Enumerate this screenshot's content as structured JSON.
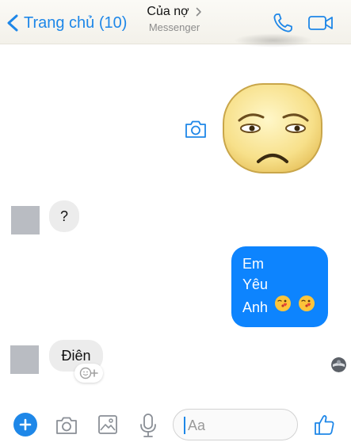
{
  "header": {
    "back_label": "Trang chủ (10)",
    "title": "Của nợ",
    "subtitle": "Messenger",
    "icons": {
      "back": "chevron-left-icon",
      "title_arrow": "chevron-right-icon",
      "call": "phone-icon",
      "video": "video-camera-icon"
    }
  },
  "messages": [
    {
      "from": "me",
      "type": "sticker",
      "icon": "sad-face-sticker"
    },
    {
      "from": "them",
      "type": "text",
      "text": "?"
    },
    {
      "from": "me",
      "type": "text",
      "lines": [
        "Em",
        "Yêu",
        "Anh"
      ],
      "emojis": [
        "kissing-heart-emoji",
        "kissing-heart-emoji"
      ]
    },
    {
      "from": "them",
      "type": "text",
      "text": "Điên"
    }
  ],
  "composer": {
    "placeholder": "Aa",
    "icons": [
      "plus-icon",
      "camera-icon",
      "image-icon",
      "microphone-icon",
      "emoji-icon",
      "thumbs-up-icon"
    ]
  },
  "colors": {
    "accent": "#1e87e8",
    "outgoing_bubble": "#0d84fe",
    "incoming_bubble": "#ececec",
    "avatar_placeholder": "#b9bcc2"
  }
}
